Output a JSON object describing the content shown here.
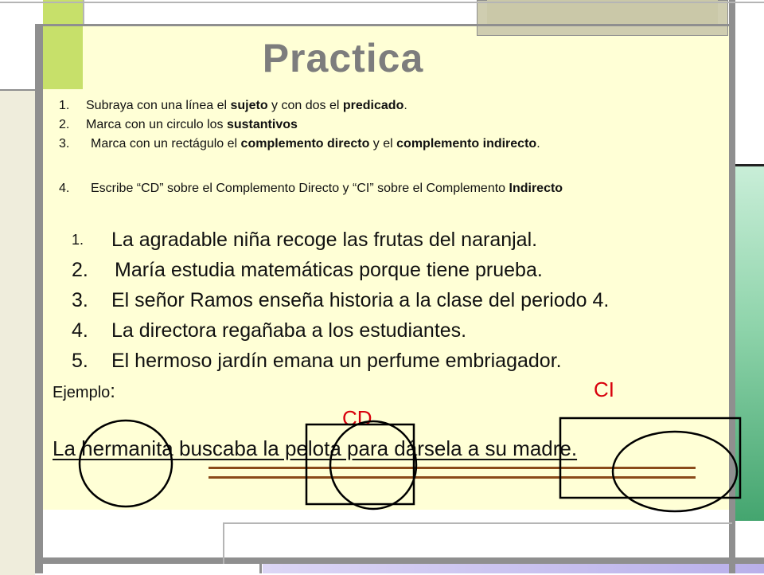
{
  "title": "Practica",
  "instructions": [
    {
      "num": "1.",
      "parts": [
        "Subraya con una línea el ",
        "sujeto",
        " y con dos el ",
        "predicado",
        "."
      ]
    },
    {
      "num": "2.",
      "parts": [
        "Marca con un circulo los ",
        "sustantivos"
      ]
    },
    {
      "num": "3.",
      "parts": [
        "Marca con un rectágulo el ",
        "complemento directo",
        " y el ",
        "complemento indirecto",
        "."
      ]
    },
    {
      "num": "4.",
      "parts": [
        "Escribe “CD” sobre el Complemento Directo y “CI” sobre el Complemento ",
        "Indirecto"
      ]
    }
  ],
  "sentences": [
    {
      "num": "1.",
      "text": "La agradable niña recoge las frutas del naranjal."
    },
    {
      "num": "2.",
      "text": "María estudia matemáticas porque tiene prueba."
    },
    {
      "num": "3.",
      "text": "El señor Ramos enseña historia a la clase del periodo 4."
    },
    {
      "num": "4.",
      "text": "La directora regañaba a los estudiantes."
    },
    {
      "num": "5.",
      "text": "El  hermoso jardín emana un perfume embriagador."
    }
  ],
  "example": {
    "label": "Ejemplo",
    "colon": ":",
    "ci_label": "CI",
    "cd_label": "CD",
    "sentence": "La hermanita buscaba la pelota para dársela a su madre."
  },
  "colors": {
    "title": "#7d7d7d",
    "annotation_red": "#d8000c",
    "underline_brown": "#8a4a1a"
  }
}
